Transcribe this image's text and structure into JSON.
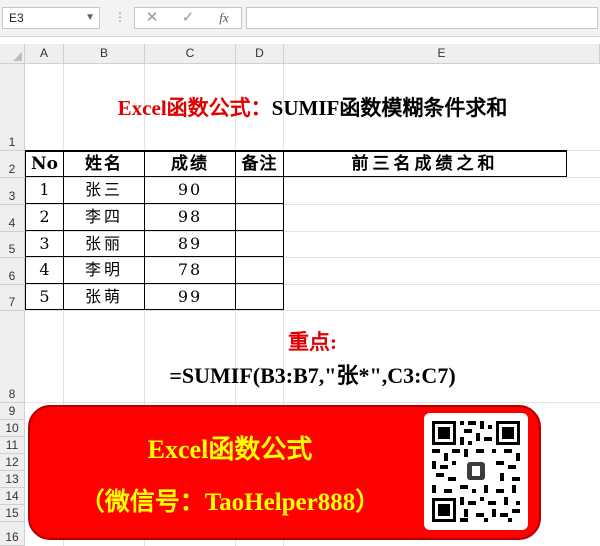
{
  "formula_bar": {
    "name_box": "E3",
    "menu_dots": "⋮",
    "cancel_glyph": "✕",
    "enter_glyph": "✓",
    "fx_glyph": "fx",
    "formula": ""
  },
  "columns": [
    "A",
    "B",
    "C",
    "D",
    "E"
  ],
  "rows": [
    "1",
    "2",
    "3",
    "4",
    "5",
    "6",
    "7",
    "8",
    "9",
    "10",
    "11",
    "12",
    "13",
    "14",
    "15",
    "16"
  ],
  "title": {
    "part1": "Excel函数公式：",
    "part2": "SUMIF函数模糊条件求和"
  },
  "table": {
    "headers": {
      "no": "No",
      "name": "姓名",
      "score": "成绩",
      "note": "备注",
      "sum": "前三名成绩之和"
    },
    "rows": [
      {
        "no": "1",
        "name": "张三",
        "score": "90"
      },
      {
        "no": "2",
        "name": "李四",
        "score": "98"
      },
      {
        "no": "3",
        "name": "张丽",
        "score": "89"
      },
      {
        "no": "4",
        "name": "李明",
        "score": "78"
      },
      {
        "no": "5",
        "name": "张萌",
        "score": "99"
      }
    ]
  },
  "key_point": {
    "label": "重点:",
    "formula": "=SUMIF(B3:B7,\"张*\",C3:C7)"
  },
  "banner": {
    "line1": "Excel函数公式",
    "line2": "（微信号：TaoHelper888）",
    "background": "#ff0000",
    "text_color": "#ffff00"
  },
  "colors": {
    "title_red": "#e00000",
    "grid": "#e3e3e3",
    "header_bg": "#efefef"
  }
}
